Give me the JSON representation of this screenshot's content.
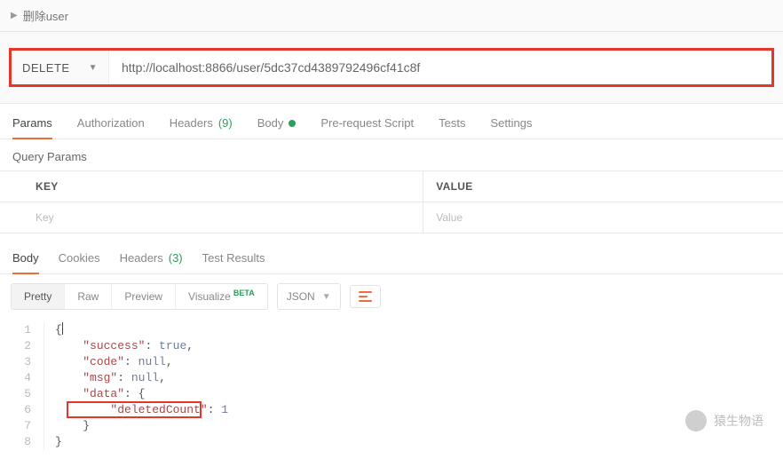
{
  "breadcrumb": {
    "title": "删除user"
  },
  "request": {
    "method": "DELETE",
    "url": "http://localhost:8866/user/5dc37cd4389792496cf41c8f"
  },
  "tabs": {
    "params": "Params",
    "authorization": "Authorization",
    "headers": "Headers",
    "headers_count": "(9)",
    "body": "Body",
    "prerequest": "Pre-request Script",
    "tests": "Tests",
    "settings": "Settings"
  },
  "query": {
    "label": "Query Params",
    "key_header": "KEY",
    "value_header": "VALUE",
    "key_placeholder": "Key",
    "value_placeholder": "Value"
  },
  "res_tabs": {
    "body": "Body",
    "cookies": "Cookies",
    "headers": "Headers",
    "headers_count": "(3)",
    "test_results": "Test Results"
  },
  "toolbar": {
    "pretty": "Pretty",
    "raw": "Raw",
    "preview": "Preview",
    "visualize": "Visualize",
    "beta": "BETA",
    "json": "JSON"
  },
  "response": {
    "lines": [
      {
        "n": "1",
        "raw": "{"
      },
      {
        "n": "2",
        "key": "\"success\"",
        "between": ": ",
        "val": "true",
        "tail": ",",
        "valClass": "v-bool"
      },
      {
        "n": "3",
        "key": "\"code\"",
        "between": ": ",
        "val": "null",
        "tail": ",",
        "valClass": "v-null"
      },
      {
        "n": "4",
        "key": "\"msg\"",
        "between": ": ",
        "val": "null",
        "tail": ",",
        "valClass": "v-null"
      },
      {
        "n": "5",
        "key": "\"data\"",
        "between": ": ",
        "val": "{",
        "tail": "",
        "valClass": "brace"
      },
      {
        "n": "6",
        "key": "\"deletedCount\"",
        "between": ": ",
        "val": "1",
        "tail": "",
        "valClass": "v-num",
        "indent": 2
      },
      {
        "n": "7",
        "raw": "    }"
      },
      {
        "n": "8",
        "raw": "}"
      }
    ]
  },
  "watermark": {
    "text": "猿生物语"
  }
}
